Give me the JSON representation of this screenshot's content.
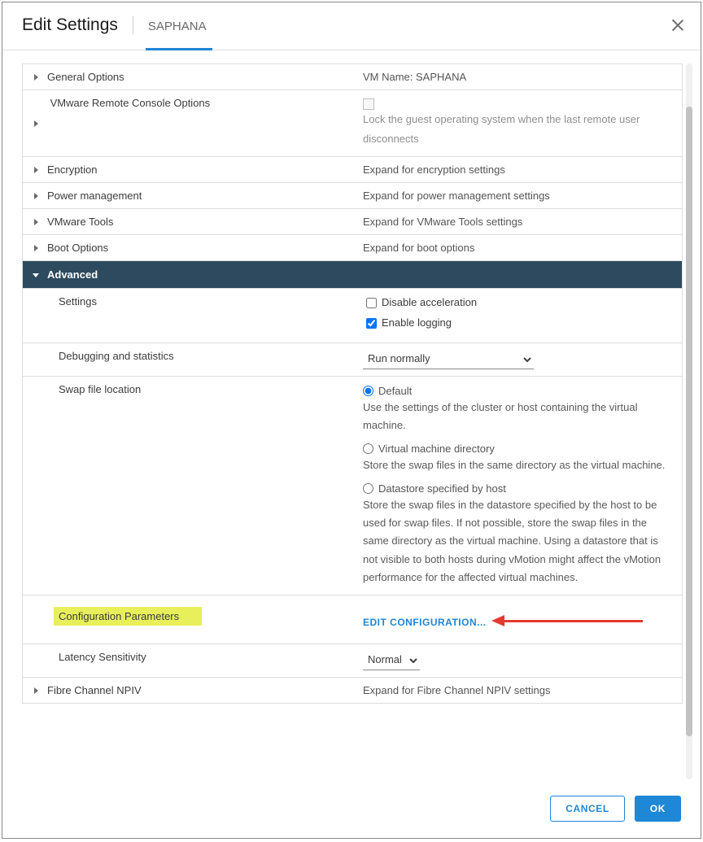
{
  "header": {
    "title": "Edit Settings",
    "subtitle": "SAPHANA"
  },
  "rows": {
    "general": {
      "label": "General Options",
      "value": "VM Name: SAPHANA"
    },
    "vmrc": {
      "label": "VMware Remote Console Options",
      "desc": "Lock the guest operating system when the last remote user disconnects"
    },
    "enc": {
      "label": "Encryption",
      "value": "Expand for encryption settings"
    },
    "power": {
      "label": "Power management",
      "value": "Expand for power management settings"
    },
    "tools": {
      "label": "VMware Tools",
      "value": "Expand for VMware Tools settings"
    },
    "boot": {
      "label": "Boot Options",
      "value": "Expand for boot options"
    },
    "advanced": {
      "label": "Advanced"
    },
    "settings": {
      "label": "Settings",
      "disable_accel": "Disable acceleration",
      "enable_logging": "Enable logging"
    },
    "debug": {
      "label": "Debugging and statistics",
      "selected": "Run normally"
    },
    "swap": {
      "label": "Swap file location",
      "opt_default": "Default",
      "opt_default_desc": "Use the settings of the cluster or host containing the virtual machine.",
      "opt_vmdir": "Virtual machine directory",
      "opt_vmdir_desc": "Store the swap files in the same directory as the virtual machine.",
      "opt_ds": "Datastore specified by host",
      "opt_ds_desc": "Store the swap files in the datastore specified by the host to be used for swap files. If not possible, store the swap files in the same directory as the virtual machine. Using a datastore that is not visible to both hosts during vMotion might affect the vMotion performance for the affected virtual machines."
    },
    "config": {
      "label": "Configuration Parameters",
      "link": "EDIT CONFIGURATION..."
    },
    "latency": {
      "label": "Latency Sensitivity",
      "selected": "Normal"
    },
    "npiv": {
      "label": "Fibre Channel NPIV",
      "value": "Expand for Fibre Channel NPIV settings"
    }
  },
  "footer": {
    "cancel": "CANCEL",
    "ok": "OK"
  }
}
